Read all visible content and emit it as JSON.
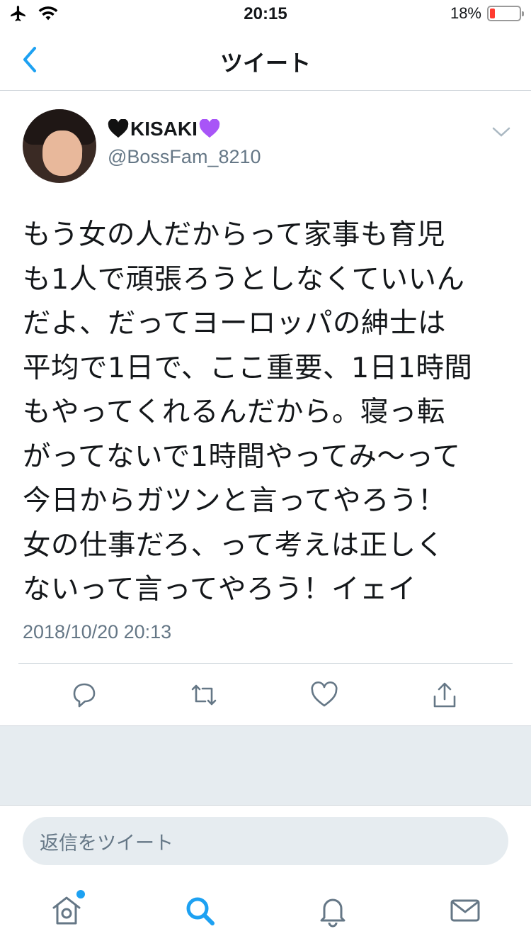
{
  "status_bar": {
    "time": "20:15",
    "battery_percent": "18%",
    "battery_level": 0.18,
    "icons": [
      "airplane-icon",
      "wifi-icon",
      "battery-icon"
    ]
  },
  "nav": {
    "title": "ツイート",
    "back_icon": "chevron-left-icon"
  },
  "tweet": {
    "user_name": "KISAKI",
    "name_emoji_left": "black-heart",
    "name_emoji_right": "purple-heart",
    "handle": "@BossFam_8210",
    "text": "もう女の人だからって家事も育児\nも1人で頑張ろうとしなくていいん\nだよ、だってヨーロッパの紳士は\n平均で1日で、ここ重要、1日1時間\nもやってくれるんだから。寝っ転\nがってないで1時間やってみ〜って\n今日からガツンと言ってやろう！\n女の仕事だろ、って考えは正しく\nないって言ってやろう！イェイ",
    "timestamp": "2018/10/20 20:13"
  },
  "actions": [
    "reply-icon",
    "retweet-icon",
    "like-icon",
    "share-icon"
  ],
  "reply": {
    "placeholder": "返信をツイート"
  },
  "tabs": [
    "home-icon",
    "search-icon",
    "notifications-icon",
    "messages-icon"
  ],
  "colors": {
    "accent": "#1da1f2",
    "icon_gray": "#657786",
    "background_gray": "#e6ecf0",
    "battery_red": "#ff3b30",
    "purple_heart": "#a855f7"
  }
}
